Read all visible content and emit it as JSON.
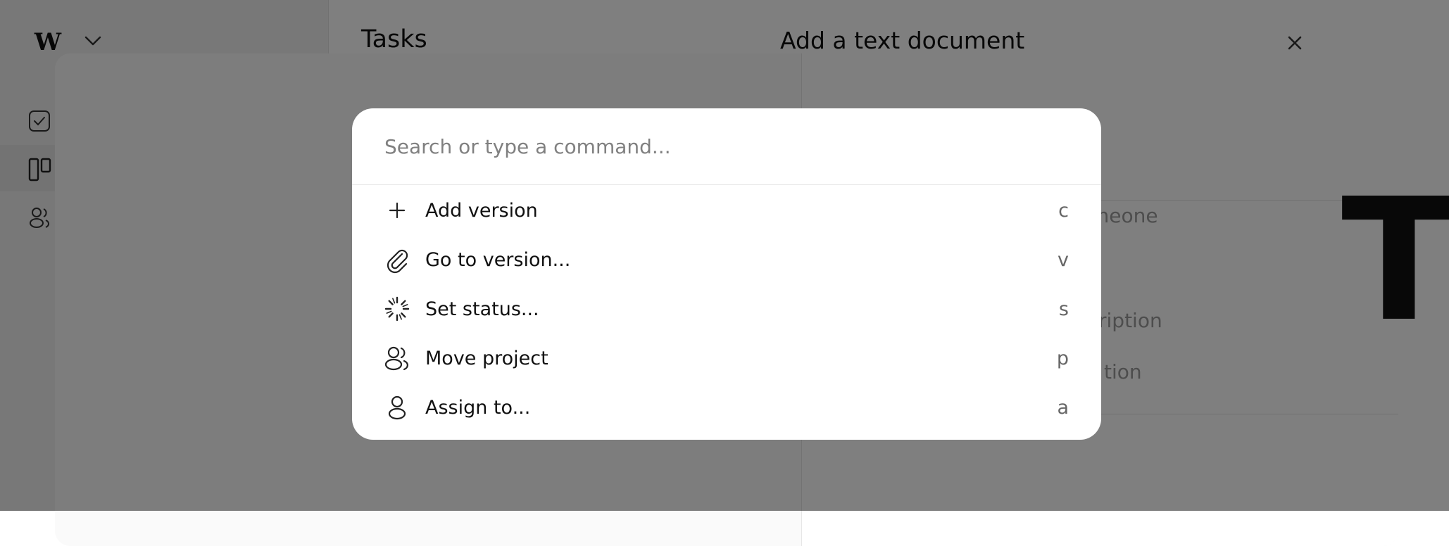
{
  "app": {
    "logo_text": "W",
    "main_title": "Tasks"
  },
  "drawer": {
    "title": "Add a text document",
    "hints": [
      "meone",
      "ription",
      "tion"
    ],
    "glyph": "T"
  },
  "palette": {
    "search_placeholder": "Search or type a command...",
    "commands": [
      {
        "label": "Add version",
        "shortcut": "c",
        "icon": "plus-icon"
      },
      {
        "label": "Go to version...",
        "shortcut": "v",
        "icon": "paperclip-icon"
      },
      {
        "label": "Set status...",
        "shortcut": "s",
        "icon": "loading-spinner-icon"
      },
      {
        "label": "Move project",
        "shortcut": "p",
        "icon": "users-icon"
      },
      {
        "label": "Assign to...",
        "shortcut": "a",
        "icon": "user-icon"
      }
    ]
  },
  "colors": {
    "overlay": "rgba(0,0,0,0.5)",
    "text": "#111111",
    "muted": "#808080"
  }
}
